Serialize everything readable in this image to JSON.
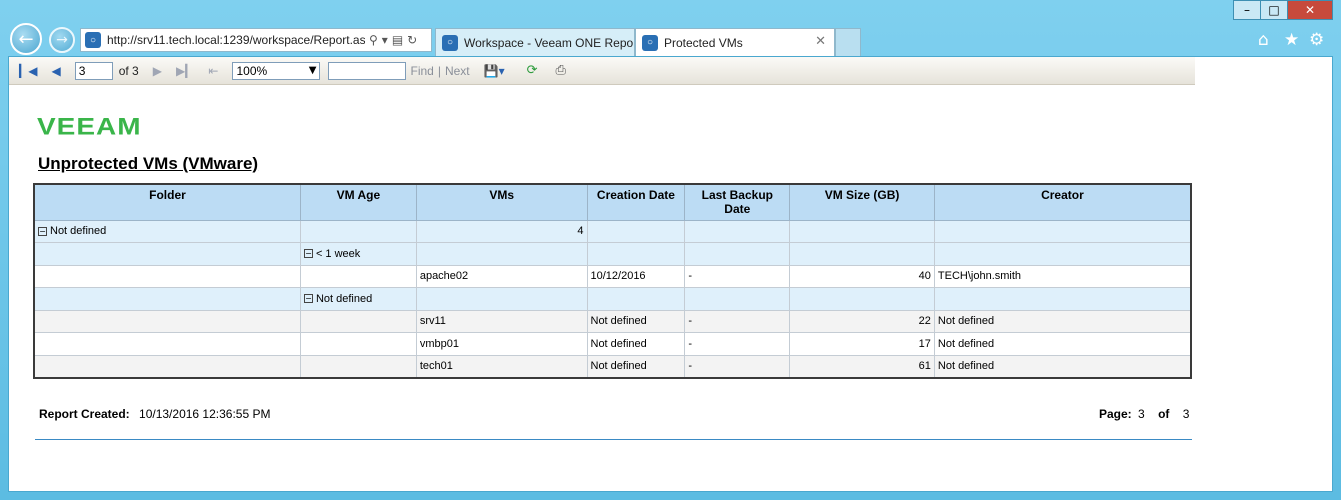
{
  "browser": {
    "address_url": "http://srv11.tech.local:1239/workspace/Report.as",
    "tabs": [
      {
        "label": "Workspace - Veeam ONE Repo..."
      },
      {
        "label": "Protected VMs"
      }
    ]
  },
  "toolbar": {
    "current_page": "3",
    "of_label": "of 3",
    "zoom": "100%",
    "find_value": "",
    "find_label": "Find",
    "next_label": "Next"
  },
  "report": {
    "logo": "VEEAM",
    "title": "Unprotected VMs (VMware)",
    "columns": [
      "Folder",
      "VM Age",
      "VMs",
      "Creation Date",
      "Last Backup Date",
      "VM Size (GB)",
      "Creator"
    ],
    "rows": [
      {
        "folder": "Not defined",
        "age": "",
        "vms": "4",
        "date": "",
        "backup": "",
        "size": "",
        "creator": ""
      },
      {
        "folder": "",
        "age": "< 1 week",
        "vms": "",
        "date": "",
        "backup": "",
        "size": "",
        "creator": ""
      },
      {
        "folder": "",
        "age": "",
        "vms": "apache02",
        "date": "10/12/2016",
        "backup": "-",
        "size": "40",
        "creator": "TECH\\john.smith"
      },
      {
        "folder": "",
        "age": "Not defined",
        "vms": "",
        "date": "",
        "backup": "",
        "size": "",
        "creator": ""
      },
      {
        "folder": "",
        "age": "",
        "vms": "srv11",
        "date": "Not defined",
        "backup": "-",
        "size": "22",
        "creator": "Not defined"
      },
      {
        "folder": "",
        "age": "",
        "vms": "vmbp01",
        "date": "Not defined",
        "backup": "-",
        "size": "17",
        "creator": "Not defined"
      },
      {
        "folder": "",
        "age": "",
        "vms": "tech01",
        "date": "Not defined",
        "backup": "-",
        "size": "61",
        "creator": "Not defined"
      }
    ],
    "created_label": "Report Created:",
    "created_value": "10/13/2016 12:36:55 PM",
    "page_label": "Page:",
    "page_value": "3",
    "of_label": "of",
    "page_total": "3"
  }
}
